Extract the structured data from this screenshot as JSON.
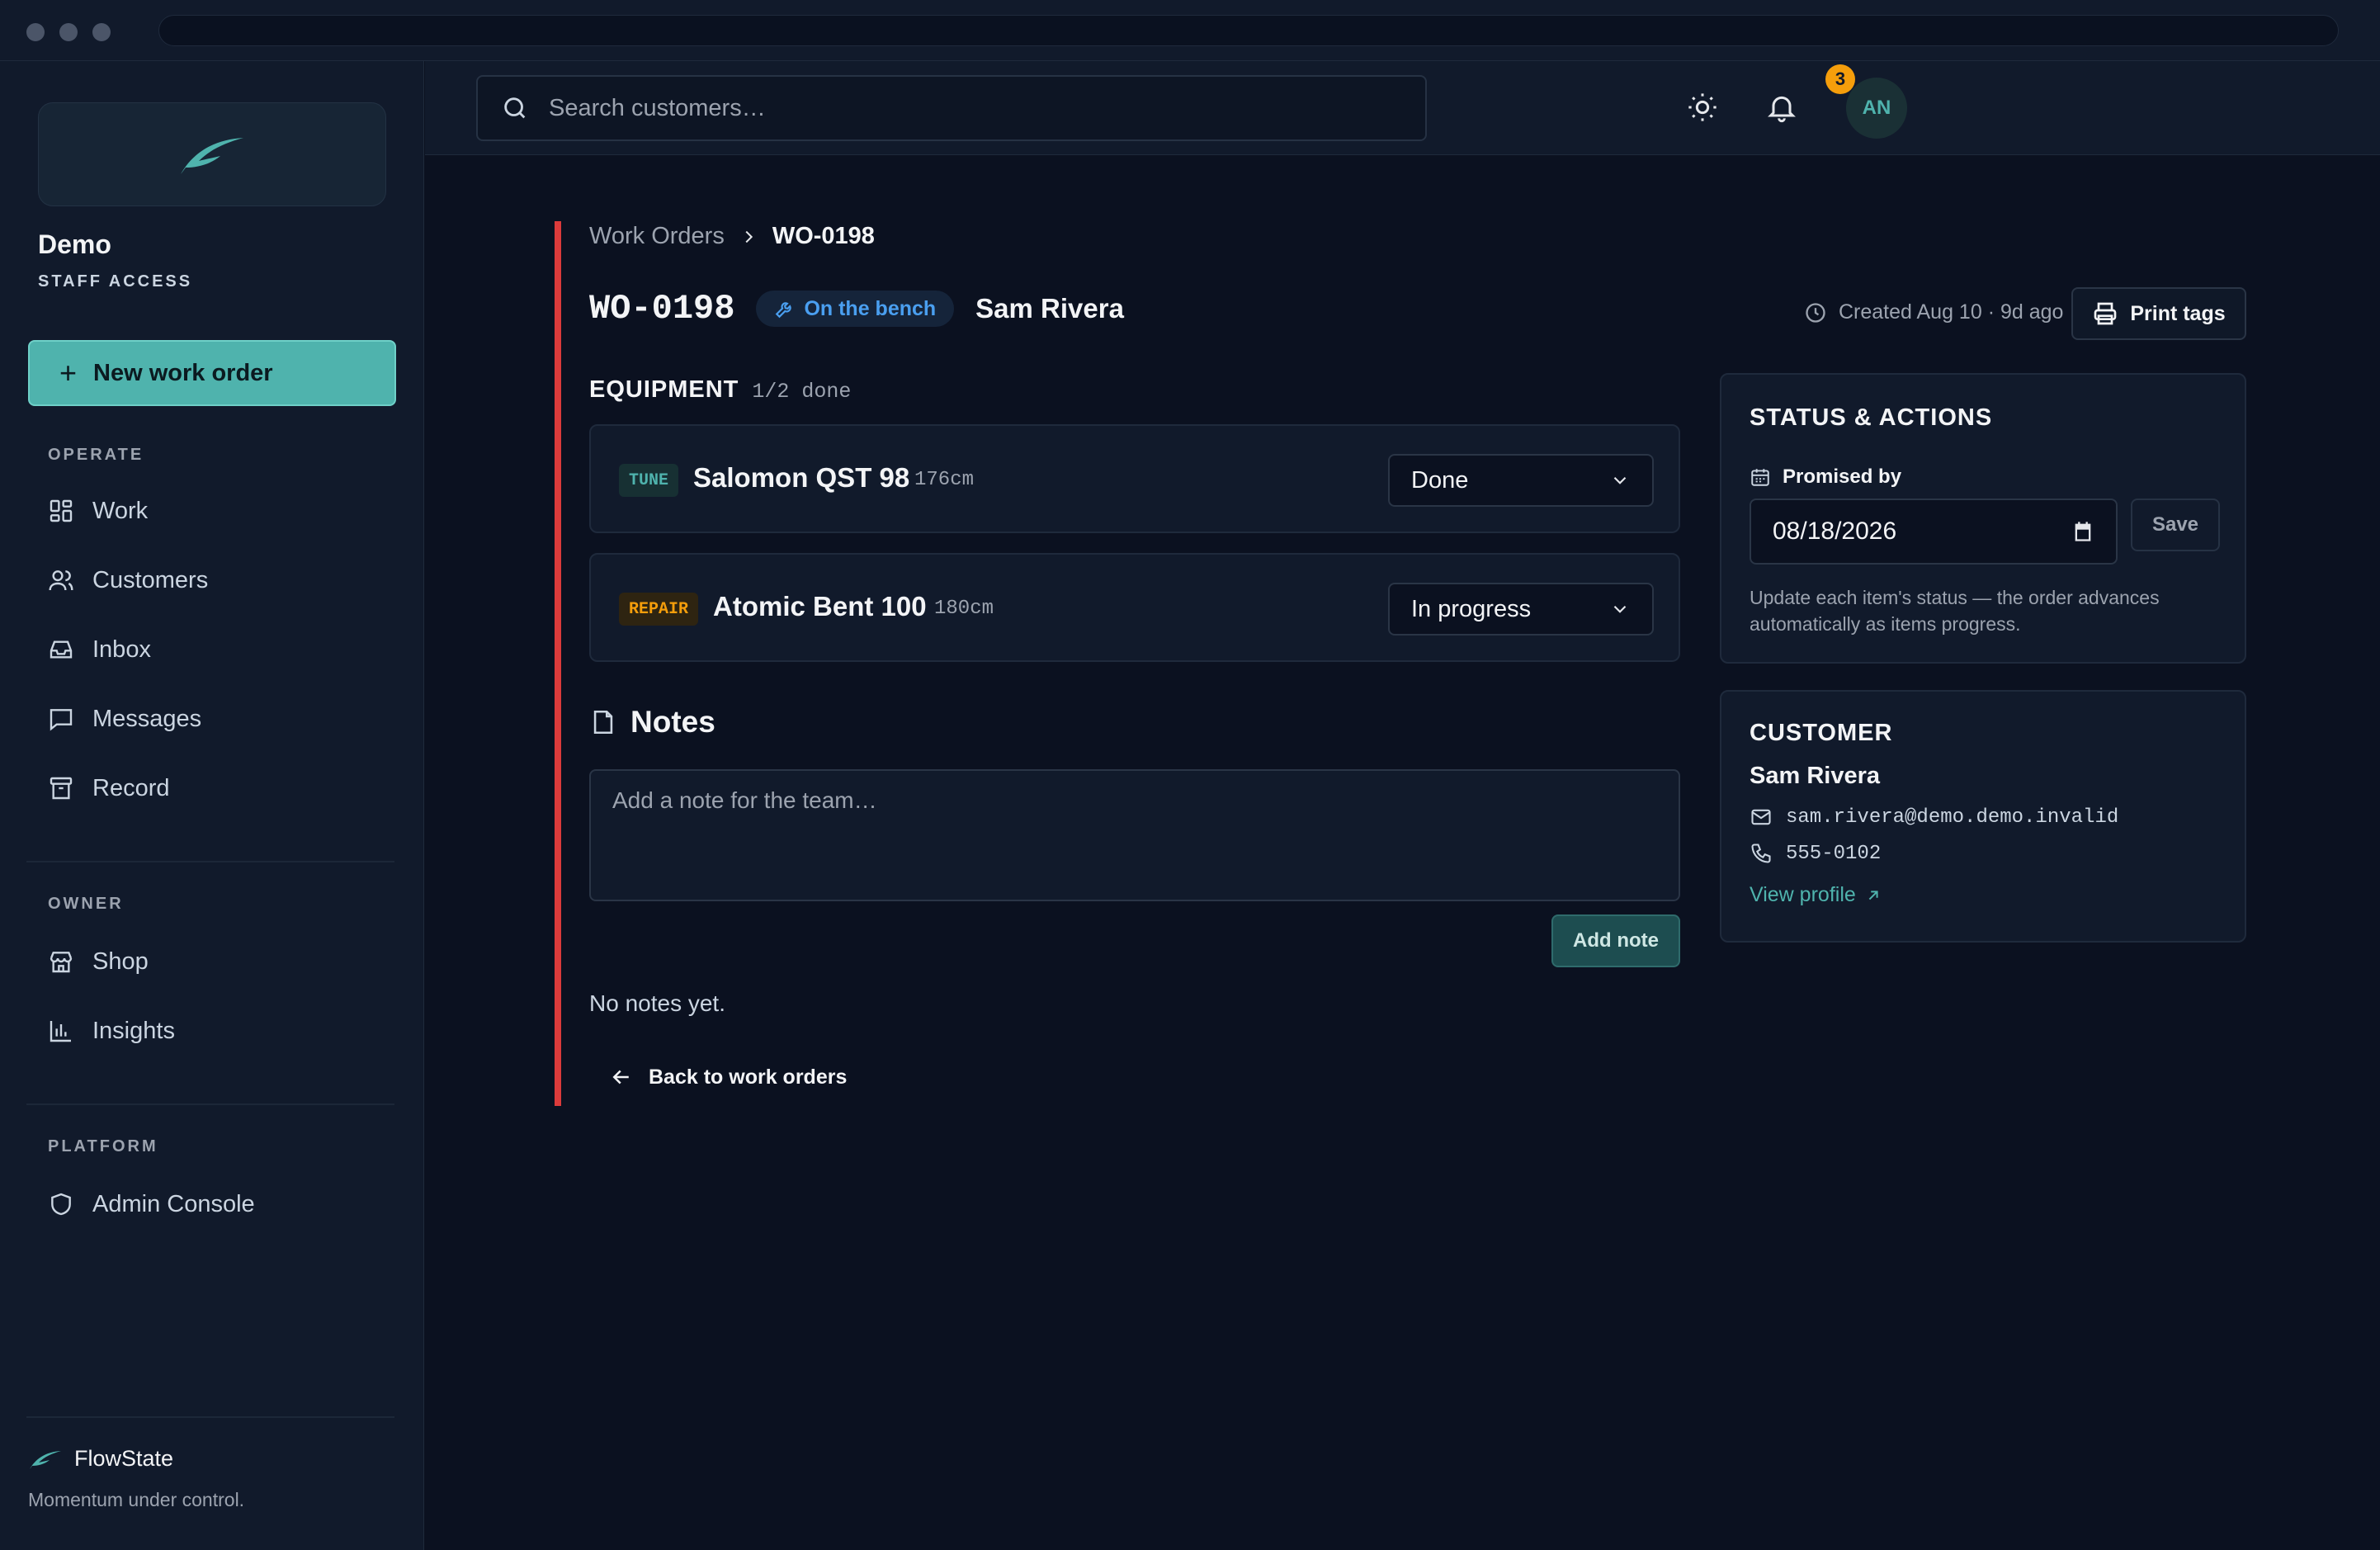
{
  "sidebar": {
    "brand_name": "Demo",
    "brand_sub": "STAFF ACCESS",
    "new_button": "New work order",
    "sections": {
      "operate": "OPERATE",
      "owner": "OWNER",
      "platform": "PLATFORM"
    },
    "items": {
      "work": "Work",
      "customers": "Customers",
      "inbox": "Inbox",
      "messages": "Messages",
      "record": "Record",
      "shop": "Shop",
      "insights": "Insights",
      "admin": "Admin Console"
    },
    "footer_brand": "FlowState",
    "footer_tagline": "Momentum under control."
  },
  "topbar": {
    "search_placeholder": "Search customers…",
    "notification_count": "3",
    "avatar_initials": "AN",
    "icons": [
      "search-icon",
      "sun-icon",
      "bell-icon"
    ]
  },
  "breadcrumb": {
    "parent": "Work Orders",
    "current": "WO-0198"
  },
  "order": {
    "id": "WO-0198",
    "status": "On the bench",
    "customer_name": "Sam Rivera",
    "created": "Created Aug 10 · 9d ago",
    "print_label": "Print tags"
  },
  "equipment": {
    "heading": "EQUIPMENT",
    "progress": "1/2 done",
    "items": [
      {
        "tag": "TUNE",
        "name": "Salomon QST 98",
        "length": "176cm",
        "status": "Done"
      },
      {
        "tag": "REPAIR",
        "name": "Atomic Bent 100",
        "length": "180cm",
        "status": "In progress"
      }
    ]
  },
  "notes": {
    "heading": "Notes",
    "placeholder": "Add a note for the team…",
    "add_label": "Add note",
    "empty": "No notes yet."
  },
  "back_label": "Back to work orders",
  "status_panel": {
    "title": "STATUS & ACTIONS",
    "promised_label": "Promised by",
    "promised_date": "08/18/2026",
    "save_label": "Save",
    "help": "Update each item's status — the order advances automatically as items progress."
  },
  "customer_panel": {
    "title": "CUSTOMER",
    "name": "Sam Rivera",
    "email": "sam.rivera@demo.demo.invalid",
    "phone": "555-0102",
    "profile_link": "View profile"
  },
  "colors": {
    "accent": "#4fb3ad",
    "danger_bar": "#dc3b3b",
    "status_blue": "#4a9ff0",
    "badge": "#f59e0b",
    "tune_tag": "#4fb3ad",
    "repair_tag": "#f59e0b"
  }
}
